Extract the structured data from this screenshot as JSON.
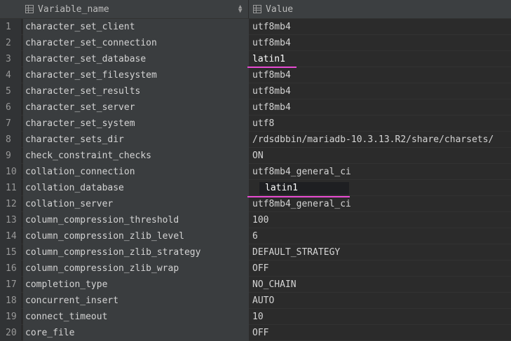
{
  "header": {
    "col_name": "Variable_name",
    "col_value": "Value",
    "table_icon": "table-column-icon",
    "sort_icon": "sort-arrows-icon"
  },
  "rows": [
    {
      "n": "1",
      "name": "character_set_client",
      "value": "utf8mb4"
    },
    {
      "n": "2",
      "name": "character_set_connection",
      "value": "utf8mb4"
    },
    {
      "n": "3",
      "name": "character_set_database",
      "value": "latin1"
    },
    {
      "n": "4",
      "name": "character_set_filesystem",
      "value": "utf8mb4"
    },
    {
      "n": "5",
      "name": "character_set_results",
      "value": "utf8mb4"
    },
    {
      "n": "6",
      "name": "character_set_server",
      "value": "utf8mb4"
    },
    {
      "n": "7",
      "name": "character_set_system",
      "value": "utf8"
    },
    {
      "n": "8",
      "name": "character_sets_dir",
      "value": "/rdsdbbin/mariadb-10.3.13.R2/share/charsets/"
    },
    {
      "n": "9",
      "name": "check_constraint_checks",
      "value": "ON"
    },
    {
      "n": "10",
      "name": "collation_connection",
      "value": "utf8mb4_general_ci"
    },
    {
      "n": "11",
      "name": "collation_database",
      "value": ""
    },
    {
      "n": "12",
      "name": "collation_server",
      "value": "utf8mb4_general_ci"
    },
    {
      "n": "13",
      "name": "column_compression_threshold",
      "value": "100"
    },
    {
      "n": "14",
      "name": "column_compression_zlib_level",
      "value": "6"
    },
    {
      "n": "15",
      "name": "column_compression_zlib_strategy",
      "value": "DEFAULT_STRATEGY"
    },
    {
      "n": "16",
      "name": "column_compression_zlib_wrap",
      "value": "OFF"
    },
    {
      "n": "17",
      "name": "completion_type",
      "value": "NO_CHAIN"
    },
    {
      "n": "18",
      "name": "concurrent_insert",
      "value": "AUTO"
    },
    {
      "n": "19",
      "name": "connect_timeout",
      "value": "10"
    },
    {
      "n": "20",
      "name": "core_file",
      "value": "OFF"
    }
  ],
  "popup": {
    "text": "latin1"
  },
  "colors": {
    "highlight_underline": "#e84bd3",
    "background": "#2b2b2b"
  }
}
